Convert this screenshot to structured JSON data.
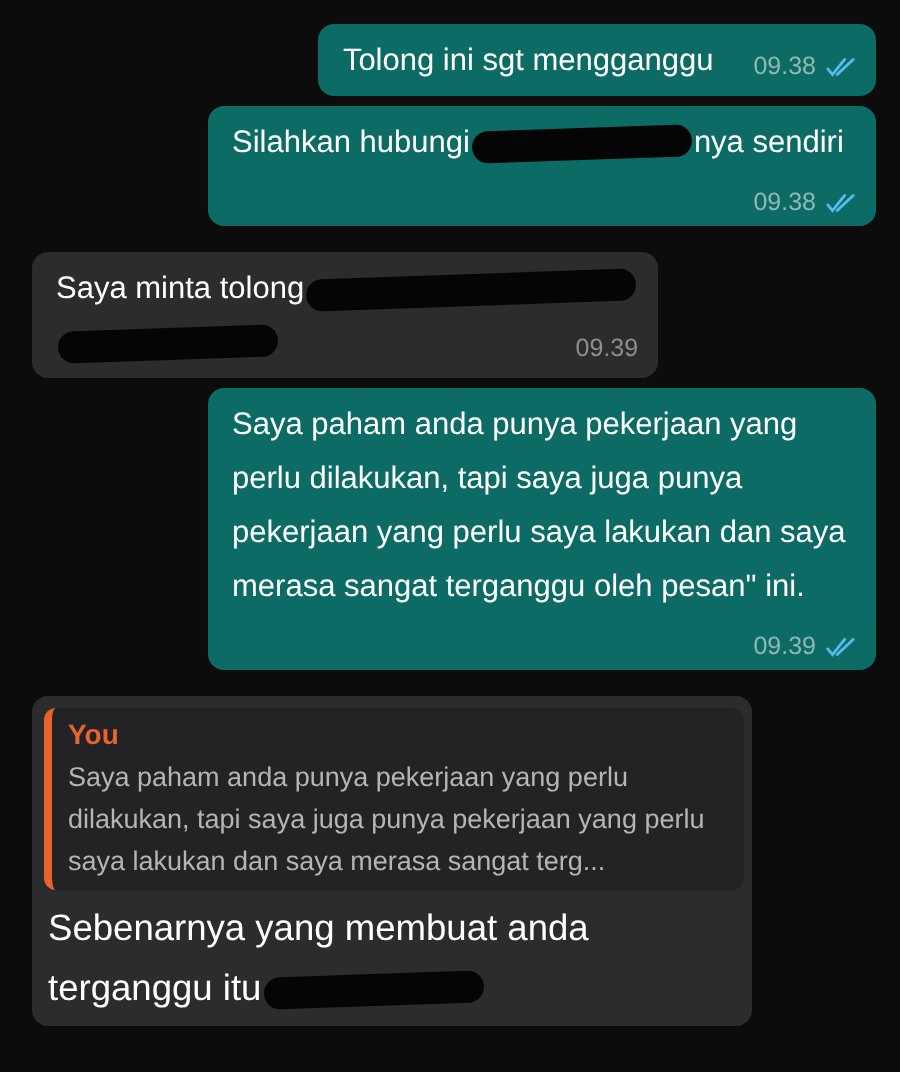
{
  "messages": [
    {
      "kind": "out",
      "segments": [
        {
          "kind": "text",
          "text": "Tolong ini sgt mengganggu"
        }
      ],
      "time": "09.38",
      "read": true
    },
    {
      "kind": "out",
      "segments": [
        {
          "kind": "text",
          "text": "Silahkan hubungi"
        },
        {
          "kind": "redaction"
        },
        {
          "kind": "text",
          "text": "nya sendiri"
        }
      ],
      "time": "09.38",
      "read": true
    },
    {
      "kind": "in",
      "segments": [
        {
          "kind": "text",
          "text": "Saya minta tolong"
        },
        {
          "kind": "redaction"
        },
        {
          "kind": "break"
        },
        {
          "kind": "redaction"
        }
      ],
      "time": "09.39"
    },
    {
      "kind": "out",
      "segments": [
        {
          "kind": "text",
          "text": "Saya paham anda punya pekerjaan yang perlu dilakukan, tapi saya juga punya pekerjaan yang perlu saya lakukan dan saya merasa sangat terganggu oleh pesan\" ini."
        }
      ],
      "time": "09.39",
      "read": true
    },
    {
      "kind": "in",
      "quote": {
        "author": "You",
        "text": "Saya paham anda punya pekerjaan yang perlu dilakukan, tapi saya juga punya pekerjaan yang perlu saya lakukan dan saya merasa sangat terg..."
      },
      "segments": [
        {
          "kind": "text",
          "text": "Sebenarnya yang membuat anda"
        },
        {
          "kind": "break"
        },
        {
          "kind": "text",
          "text": "terganggu itu"
        },
        {
          "kind": "redaction"
        }
      ]
    }
  ]
}
